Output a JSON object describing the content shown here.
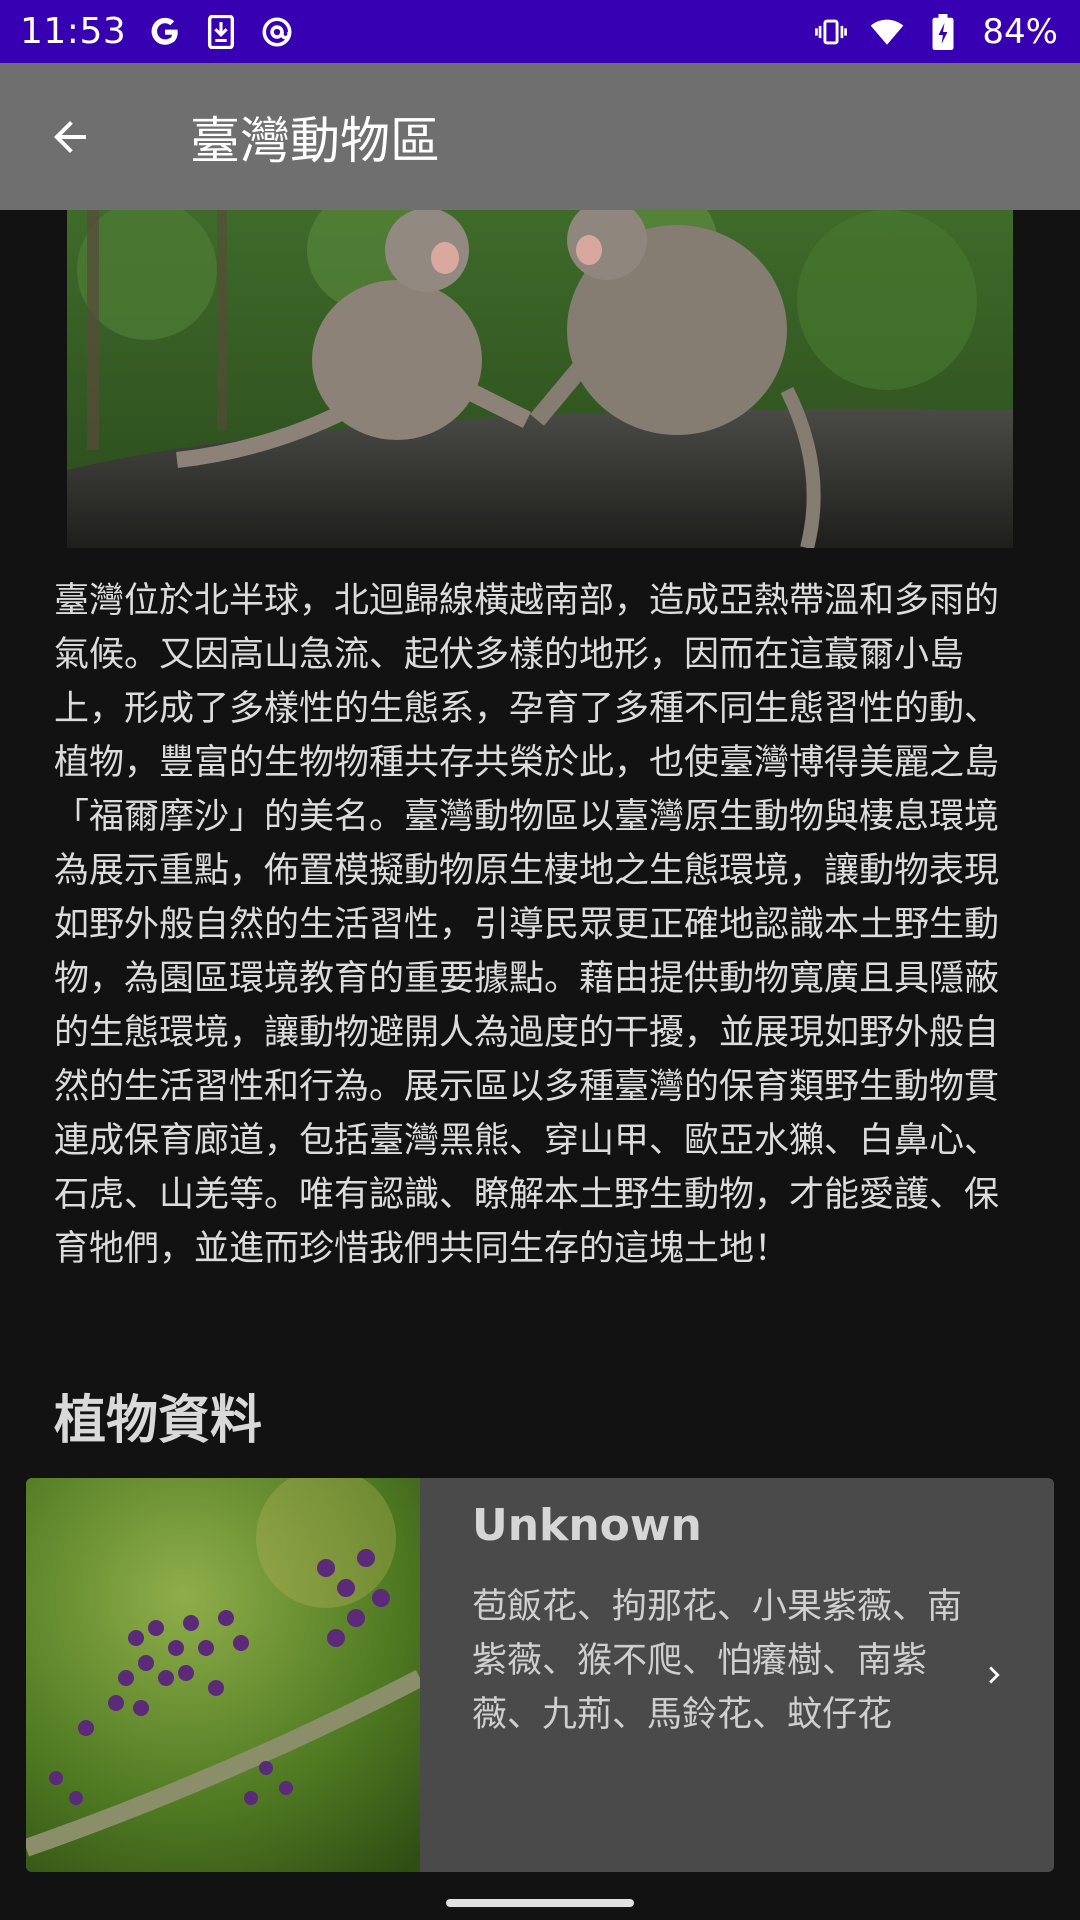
{
  "status_bar": {
    "time": "11:53",
    "left_icons": [
      "google-icon",
      "download-icon",
      "at-sign-icon"
    ],
    "right_icons": [
      "vibrate-icon",
      "wifi-icon",
      "battery-charging-icon"
    ],
    "battery": "84%",
    "background": "#3700b3"
  },
  "app_bar": {
    "title": "臺灣動物區",
    "back_icon": "arrow-back-icon",
    "background": "#6f6f6f"
  },
  "hero_image": {
    "subject": "two Formosan macaques sitting on a log"
  },
  "description": "臺灣位於北半球，北迴歸線橫越南部，造成亞熱帶溫和多雨的氣候。又因高山急流、起伏多樣的地形，因而在這蕞爾小島上，形成了多樣性的生態系，孕育了多種不同生態習性的動、植物，豐富的生物物種共存共榮於此，也使臺灣博得美麗之島「福爾摩沙」的美名。臺灣動物區以臺灣原生動物與棲息環境為展示重點，佈置模擬動物原生棲地之生態環境，讓動物表現如野外般自然的生活習性，引導民眾更正確地認識本土野生動物，為園區環境教育的重要據點。藉由提供動物寬廣且具隱蔽的生態環境，讓動物避開人為過度的干擾，並展現如野外般自然的生活習性和行為。展示區以多種臺灣的保育類野生動物貫連成保育廊道，包括臺灣黑熊、穿山甲、歐亞水獺、白鼻心、石虎、山羌等。唯有認識、瞭解本土野生動物，才能愛護、保育牠們，並進而珍惜我們共同生存的這塊土地！",
  "plants_section": {
    "title": "植物資料",
    "cards": [
      {
        "title": "Unknown",
        "names": "苞飯花、拘那花、小果紫薇、南紫薇、猴不爬、怕癢樹、南紫薇、九荊、馬鈴花、蚊仔花",
        "chevron_icon": "chevron-right-icon",
        "image_subject": "purple berry cluster on a branch"
      }
    ]
  }
}
